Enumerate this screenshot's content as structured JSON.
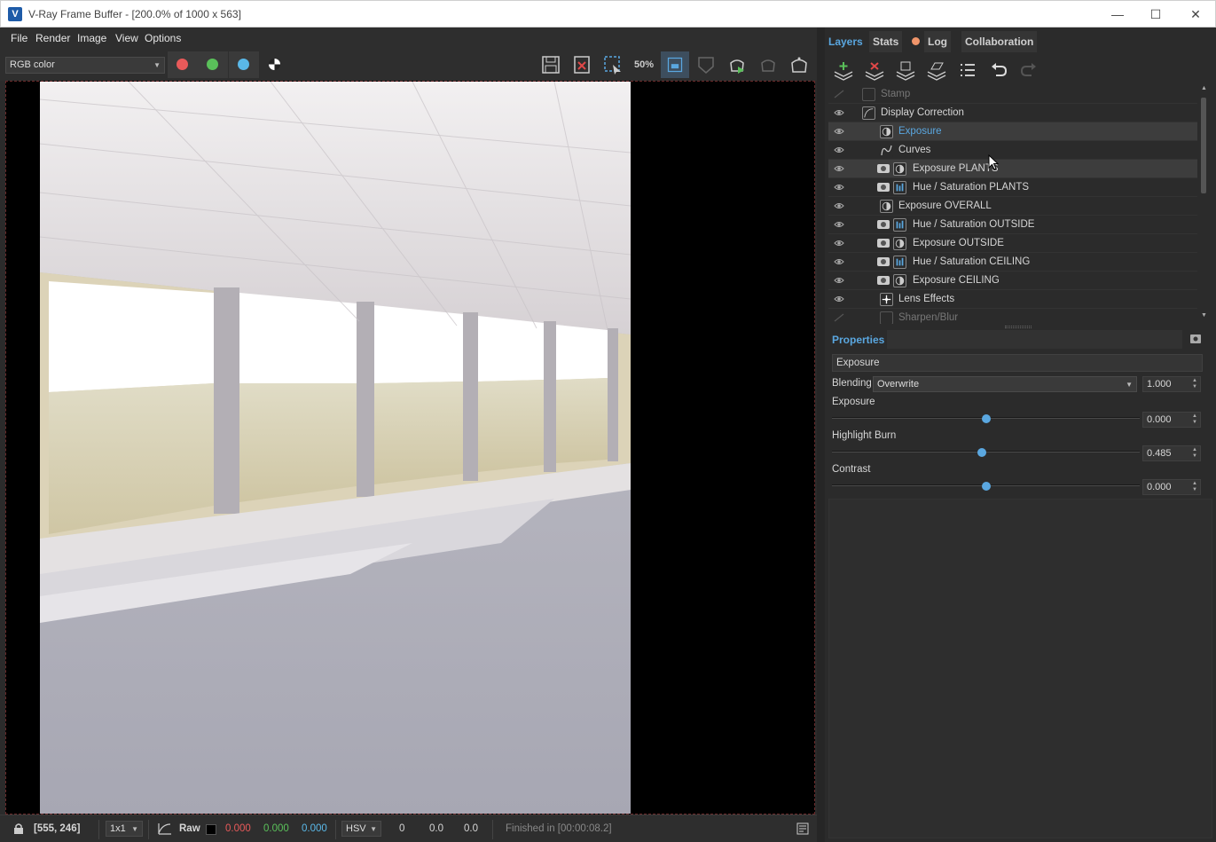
{
  "window": {
    "title": "V-Ray Frame Buffer - [200.0% of 1000 x 563]",
    "app_icon_letter": "V",
    "minimize": "—",
    "maximize": "☐",
    "close": "✕"
  },
  "menu": [
    "File",
    "Render",
    "Image",
    "View",
    "Options"
  ],
  "toolbar": {
    "channel_select": "RGB color",
    "zoom_label": "50%",
    "colors": {
      "red": "#e85a5a",
      "green": "#5ac05a",
      "blue": "#5ab8e8",
      "accent": "#5aa7e0"
    }
  },
  "tabs": [
    {
      "label": "Layers",
      "active": true
    },
    {
      "label": "Stats",
      "active": false
    },
    {
      "label": "Log",
      "active": false
    },
    {
      "label": "Collaboration",
      "active": false
    }
  ],
  "layers": [
    {
      "label": "Stamp",
      "indent": 0,
      "dim": true
    },
    {
      "label": "Display Correction",
      "indent": 0,
      "icon": "curve-icon"
    },
    {
      "label": "Exposure",
      "indent": 1,
      "icon": "exposure-icon",
      "selected": true
    },
    {
      "label": "Curves",
      "indent": 1,
      "icon": "curves-icon"
    },
    {
      "label": "Exposure PLANTS",
      "indent": 1,
      "icon": "exposure-icon",
      "mask": true
    },
    {
      "label": "Hue / Saturation PLANTS",
      "indent": 1,
      "icon": "hue-saturation-icon",
      "mask": true
    },
    {
      "label": "Exposure OVERALL",
      "indent": 1,
      "icon": "exposure-icon"
    },
    {
      "label": "Hue / Saturation OUTSIDE",
      "indent": 1,
      "icon": "hue-saturation-icon",
      "mask": true
    },
    {
      "label": "Exposure OUTSIDE",
      "indent": 1,
      "icon": "exposure-icon",
      "mask": true
    },
    {
      "label": "Hue / Saturation CEILING",
      "indent": 1,
      "icon": "hue-saturation-icon",
      "mask": true
    },
    {
      "label": "Exposure CEILING",
      "indent": 1,
      "icon": "exposure-icon",
      "mask": true
    },
    {
      "label": "Lens Effects",
      "indent": 1,
      "icon": "lens-effects-icon"
    },
    {
      "label": "Sharpen/Blur",
      "indent": 1,
      "icon": "sharpen-icon",
      "dim": true
    }
  ],
  "properties": {
    "header": "Properties",
    "name": "Exposure",
    "blending_label": "Blending",
    "blending_value": "Overwrite",
    "blending_amount": "1.000",
    "sliders": [
      {
        "label": "Exposure",
        "value": "0.000",
        "position": 0.5
      },
      {
        "label": "Highlight Burn",
        "value": "0.485",
        "position": 0.485
      },
      {
        "label": "Contrast",
        "value": "0.000",
        "position": 0.5
      }
    ]
  },
  "status": {
    "coords": "[555, 246]",
    "ratio": "1x1",
    "raw_label": "Raw",
    "r": "0.000",
    "g": "0.000",
    "b": "0.000",
    "color_space": "HSV",
    "h": "0",
    "s": "0.0",
    "v": "0.0",
    "message": "Finished in [00:00:08.2]"
  }
}
